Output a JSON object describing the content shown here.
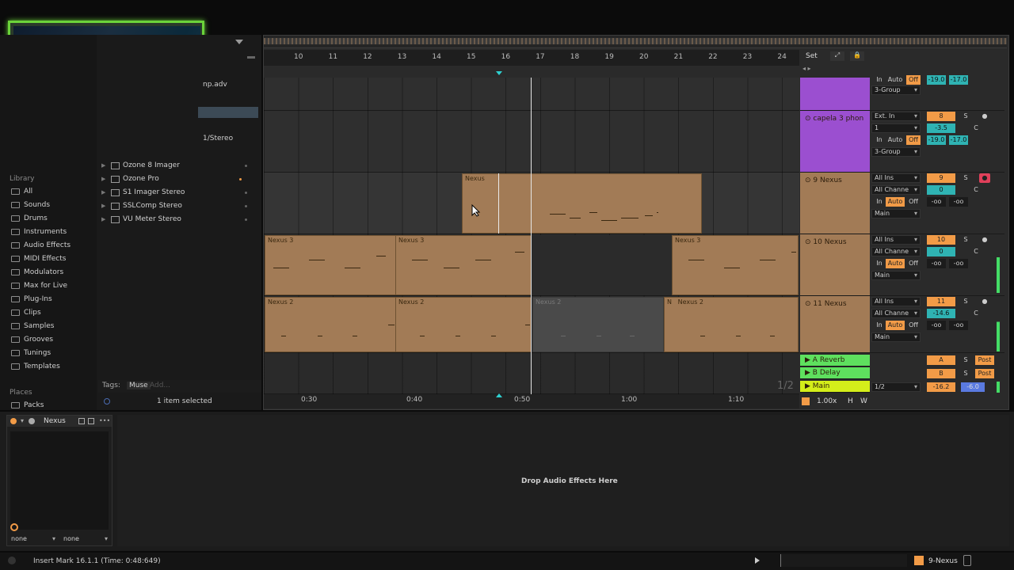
{
  "browser": {
    "collapsed_text": {
      "adv": "np.adv",
      "stereo": "1/Stereo"
    },
    "library_header": "Library",
    "library": [
      {
        "label": "All",
        "icon": "all-icon"
      },
      {
        "label": "Sounds",
        "icon": "sounds-icon"
      },
      {
        "label": "Drums",
        "icon": "drums-icon"
      },
      {
        "label": "Instruments",
        "icon": "instruments-icon"
      },
      {
        "label": "Audio Effects",
        "icon": "audio-effects-icon"
      },
      {
        "label": "MIDI Effects",
        "icon": "midi-effects-icon"
      },
      {
        "label": "Modulators",
        "icon": "modulators-icon"
      },
      {
        "label": "Max for Live",
        "icon": "max-icon"
      },
      {
        "label": "Plug-Ins",
        "icon": "plugins-icon"
      },
      {
        "label": "Clips",
        "icon": "clips-icon"
      },
      {
        "label": "Samples",
        "icon": "samples-icon"
      },
      {
        "label": "Grooves",
        "icon": "grooves-icon"
      },
      {
        "label": "Tunings",
        "icon": "tunings-icon"
      },
      {
        "label": "Templates",
        "icon": "templates-icon"
      }
    ],
    "places_header": "Places",
    "places": [
      {
        "label": "Packs"
      }
    ],
    "plugins": [
      "Ozone 8 Imager",
      "Ozone Pro",
      "S1 Imager Stereo",
      "SSLComp Stereo",
      "VU Meter Stereo"
    ],
    "tags_label": "Tags:",
    "tag": "Muse",
    "tag_add": "Add...",
    "selection": "1 item selected"
  },
  "ruler": {
    "bars": [
      "10",
      "11",
      "12",
      "13",
      "14",
      "15",
      "16",
      "17",
      "18",
      "19",
      "20",
      "21",
      "22",
      "23",
      "24"
    ],
    "set_label": "Set"
  },
  "time_ruler": [
    "0:30",
    "0:40",
    "0:50",
    "1:00",
    "1:10"
  ],
  "tracks": [
    {
      "name": "capela 3 phon",
      "input": "Ext. In",
      "channel": "1",
      "monitor": [
        "In",
        "Auto",
        "Off"
      ],
      "output": "3-Group",
      "number": "8",
      "vol": "-3.5",
      "sends": [
        "-19.0",
        "-17.0"
      ],
      "pan": "C"
    },
    {
      "name": "9 Nexus",
      "input": "All Ins",
      "channel": "All Channe",
      "monitor": [
        "In",
        "Auto",
        "Off"
      ],
      "output": "Main",
      "number": "9",
      "vol": "0",
      "sends": [
        "-oo",
        "-oo"
      ],
      "pan": "C"
    },
    {
      "name": "10 Nexus",
      "input": "All Ins",
      "channel": "All Channe",
      "monitor": [
        "In",
        "Auto",
        "Off"
      ],
      "output": "Main",
      "number": "10",
      "vol": "0",
      "sends": [
        "-oo",
        "-oo"
      ],
      "pan": "C"
    },
    {
      "name": "11 Nexus",
      "input": "All Ins",
      "channel": "All Channe",
      "monitor": [
        "In",
        "Auto",
        "Off"
      ],
      "output": "Main",
      "number": "11",
      "vol": "-14.6",
      "sends": [
        "-oo",
        "-oo"
      ],
      "pan": "C"
    }
  ],
  "top_group": {
    "monitor": [
      "In",
      "Auto",
      "Off"
    ],
    "sends": [
      "-19.0",
      "-17.0"
    ],
    "output": "3-Group"
  },
  "returns": [
    {
      "name": "A Reverb",
      "letter": "A",
      "post": "Post"
    },
    {
      "name": "B Delay",
      "letter": "B",
      "post": "Post"
    },
    {
      "name": "Main",
      "letter": "",
      "ratio": "1/2",
      "vol": "-16.2",
      "vol2": "-6.0"
    }
  ],
  "clips": {
    "nexus": "Nexus",
    "nexus3": "Nexus 3",
    "nexus2": "Nexus 2",
    "n": "N"
  },
  "page_fraction": "1/2",
  "zoom": "1.00x",
  "h_label": "H",
  "w_label": "W",
  "device": {
    "title": "Nexus",
    "sel1": "none",
    "sel2": "none",
    "drop_text": "Drop Audio Effects Here"
  },
  "status": {
    "text": "Insert Mark 16.1.1 (Time: 0:48:649)",
    "track": "9-Nexus"
  },
  "colors": {
    "clip": "#a27b56",
    "purple": "#9b4fd0",
    "green": "#5ee05e",
    "orange": "#f29b47",
    "cyan": "#2fb3b3"
  }
}
